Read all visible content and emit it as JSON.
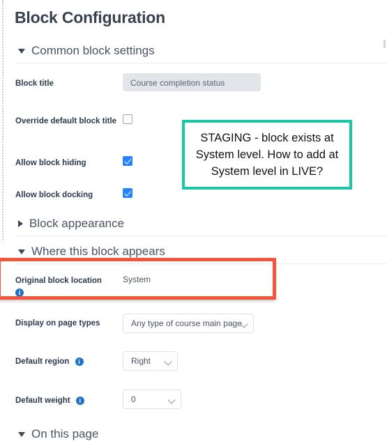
{
  "page": {
    "title": "Block Configuration"
  },
  "sections": [
    {
      "id": "common",
      "label": "Common block settings",
      "expanded": true,
      "caret": "caret-down-icon"
    },
    {
      "id": "appearance",
      "label": "Block appearance",
      "expanded": false,
      "caret": "caret-right-icon"
    },
    {
      "id": "where",
      "label": "Where this block appears",
      "expanded": true,
      "caret": "caret-down-icon"
    },
    {
      "id": "onthispage",
      "label": "On this page",
      "expanded": true,
      "caret": "caret-down-icon"
    }
  ],
  "fields": {
    "block_title": {
      "label": "Block title",
      "value": "Course completion status",
      "disabled": true
    },
    "override_default_block_title": {
      "label": "Override default block title",
      "checked": false
    },
    "allow_block_hiding": {
      "label": "Allow block hiding",
      "checked": true
    },
    "allow_block_docking": {
      "label": "Allow block docking",
      "checked": true
    },
    "original_block_location": {
      "label": "Original block location",
      "value": "System",
      "info_icon": "info-icon"
    },
    "display_on_page_types": {
      "label": "Display on page types",
      "value": "Any type of course main page",
      "chevron": "chevron-down-icon"
    },
    "default_region": {
      "label": "Default region",
      "value": "Right",
      "info_icon": "info-icon",
      "chevron": "chevron-down-icon"
    },
    "default_weight": {
      "label": "Default weight",
      "value": "0",
      "info_icon": "info-icon",
      "chevron": "chevron-down-icon"
    }
  },
  "annotations": [
    {
      "id": "teal-note",
      "text": "STAGING - block exists at System level. How to add at System level in LIVE?",
      "border_color": "#17c8a3"
    },
    {
      "id": "red-highlight",
      "border_color": "#f4563c"
    }
  ]
}
